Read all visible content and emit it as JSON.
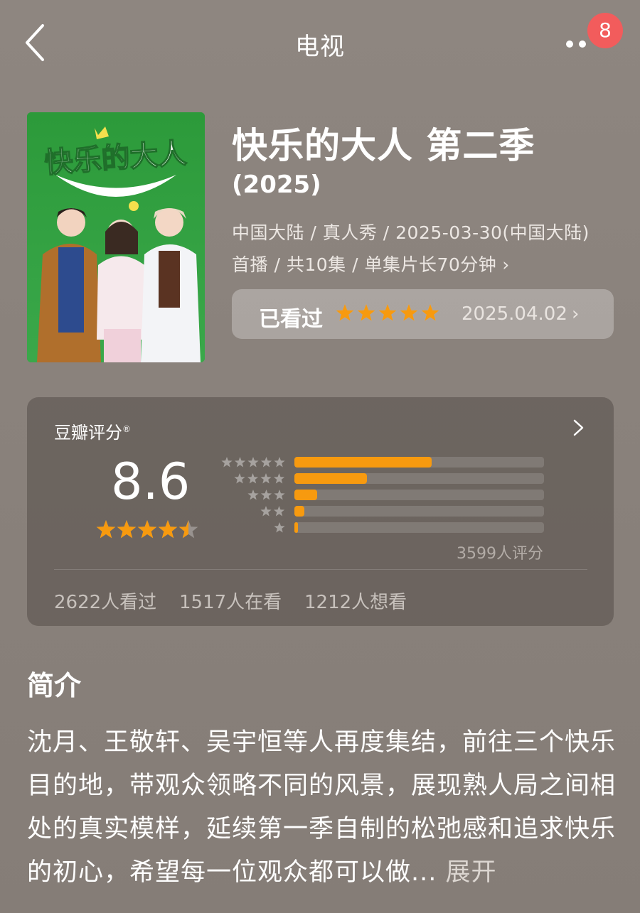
{
  "header": {
    "title": "电视",
    "back_icon": "chevron-left-icon",
    "more_icon": "more-dots-icon",
    "notification_count": "8"
  },
  "poster": {
    "title_art": "快乐的大人"
  },
  "show": {
    "title": "快乐的大人 第二季",
    "year": "(2025)",
    "meta_line1": "中国大陆 / 真人秀 / 2025-03-30(中国大陆)",
    "meta_line2": "首播 / 共10集 / 单集片长70分钟",
    "meta_more": "›"
  },
  "watched": {
    "label": "已看过",
    "user_stars": 5,
    "date": "2025.04.02",
    "chevron": "›"
  },
  "rating": {
    "label": "豆瓣评分",
    "registered": "®",
    "score": "8.6",
    "stars": 4.5,
    "distribution": [
      {
        "stars": 5,
        "fraction": 0.55
      },
      {
        "stars": 4,
        "fraction": 0.29
      },
      {
        "stars": 3,
        "fraction": 0.09
      },
      {
        "stars": 2,
        "fraction": 0.04
      },
      {
        "stars": 1,
        "fraction": 0.015
      }
    ],
    "count": "3599人评分",
    "stats": [
      "2622人看过",
      "1517人在看",
      "1212人想看"
    ]
  },
  "intro": {
    "title": "简介",
    "text": "沈月、王敬轩、吴宇恒等人再度集结，前往三个快乐目的地，带观众领略不同的风景，展现熟人局之间相处的真实模样，延续第一季自制的松弛感和追求快乐的初心，希望每一位观众都可以做...",
    "more": "展开"
  },
  "colors": {
    "star": "#f79a0f",
    "badge": "#f25c5c"
  }
}
